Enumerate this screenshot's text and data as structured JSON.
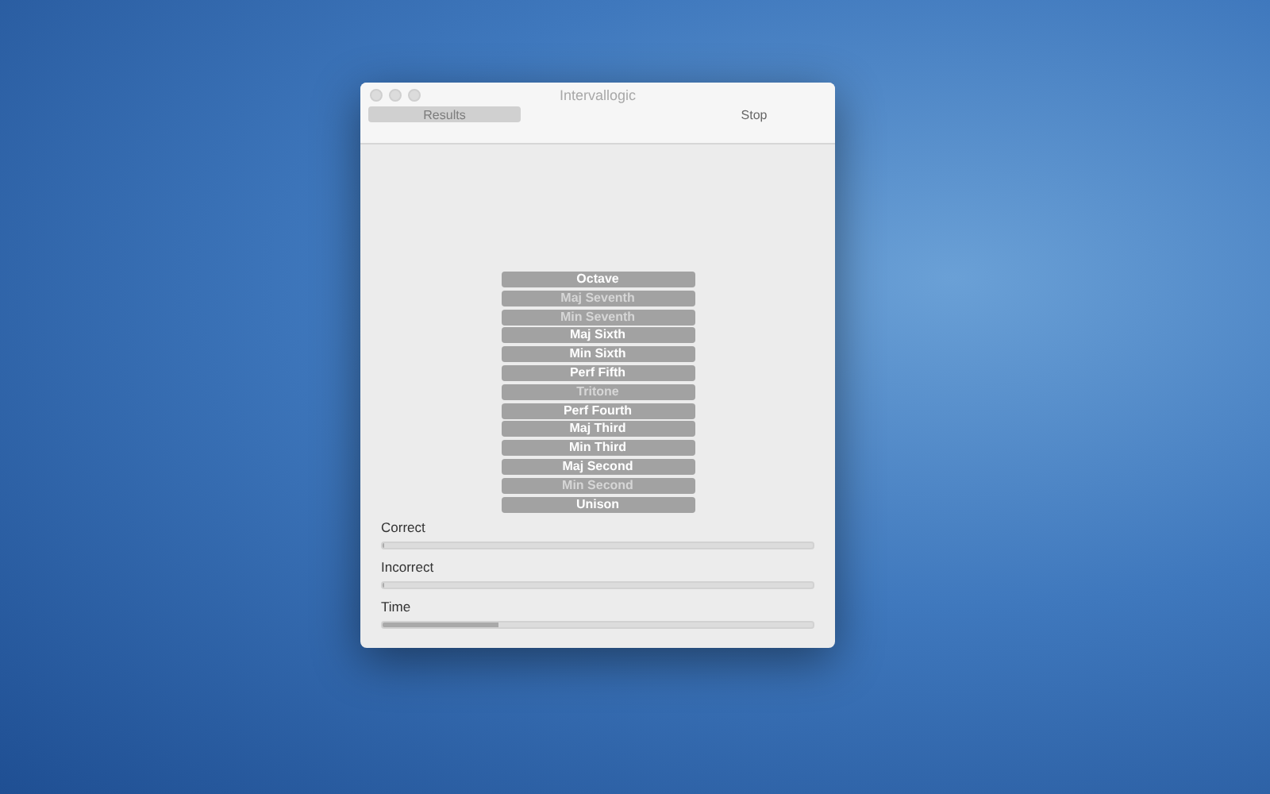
{
  "window": {
    "title": "Intervallogic"
  },
  "toolbar": {
    "results_button": {
      "label": "Results",
      "disabled": true
    },
    "stop_button": {
      "label": "Stop",
      "disabled": false
    }
  },
  "intervals": [
    {
      "label": "Octave",
      "disabled": false
    },
    {
      "label": "Maj Seventh",
      "disabled": true
    },
    {
      "label": "Min Seventh",
      "disabled": true
    },
    {
      "label": "Maj Sixth",
      "disabled": false
    },
    {
      "label": "Min Sixth",
      "disabled": false
    },
    {
      "label": "Perf Fifth",
      "disabled": false
    },
    {
      "label": "Tritone",
      "disabled": true
    },
    {
      "label": "Perf Fourth",
      "disabled": false
    },
    {
      "label": "Maj Third",
      "disabled": false
    },
    {
      "label": "Min Third",
      "disabled": false
    },
    {
      "label": "Maj Second",
      "disabled": false
    },
    {
      "label": "Min Second",
      "disabled": true
    },
    {
      "label": "Unison",
      "disabled": false
    }
  ],
  "meters": [
    {
      "label": "Correct",
      "level": 0
    },
    {
      "label": "Incorrect",
      "level": 0
    },
    {
      "label": "Time",
      "level": 0.27
    }
  ]
}
